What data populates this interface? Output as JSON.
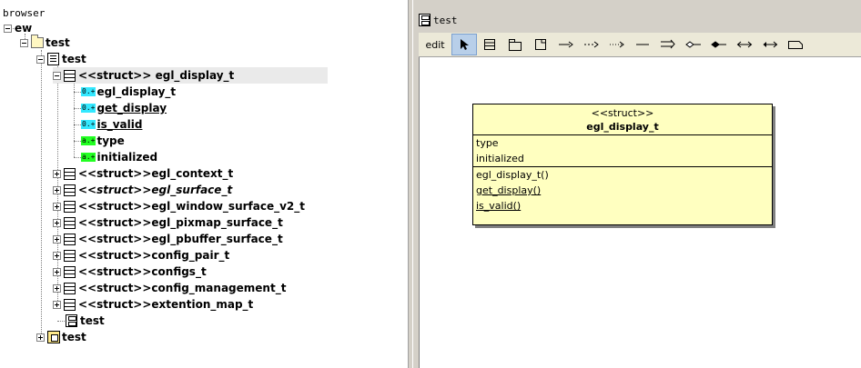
{
  "browser_panel": {
    "label": "browser",
    "root": "ew",
    "package": "test",
    "class_view": "test",
    "struct_egl_display": {
      "label": "<<struct>> egl_display_t",
      "members": [
        {
          "badge": "0.+",
          "kind": "operation",
          "label": "egl_display_t"
        },
        {
          "badge": "0.+",
          "kind": "operation",
          "label": "get_display"
        },
        {
          "badge": "0.+",
          "kind": "operation",
          "label": "is_valid"
        },
        {
          "badge": "a.+",
          "kind": "attribute",
          "label": "type"
        },
        {
          "badge": "a.+",
          "kind": "attribute",
          "label": "initialized"
        }
      ]
    },
    "structs": [
      {
        "prefix": "<<struct>> ",
        "name": "egl_context_t",
        "italic": false
      },
      {
        "prefix": "<<struct>> ",
        "name": "egl_surface_t",
        "italic": true
      },
      {
        "prefix": "<<struct>> ",
        "name": "egl_window_surface_v2_t",
        "italic": false
      },
      {
        "prefix": "<<struct>> ",
        "name": "egl_pixmap_surface_t",
        "italic": false
      },
      {
        "prefix": "<<struct>> ",
        "name": "egl_pbuffer_surface_t",
        "italic": false
      },
      {
        "prefix": "<<struct>> ",
        "name": "config_pair_t",
        "italic": false
      },
      {
        "prefix": "<<struct>> ",
        "name": "configs_t",
        "italic": false
      },
      {
        "prefix": "<<struct>> ",
        "name": "config_management_t",
        "italic": false
      },
      {
        "prefix": "<<struct>> ",
        "name": "extention_map_t",
        "italic": false
      }
    ],
    "diagram": "test",
    "deployment_view": "test"
  },
  "diagram_panel": {
    "tab_title": "test",
    "toolbar": {
      "edit_label": "edit",
      "tools": [
        "select-arrow",
        "class",
        "package",
        "note",
        "generalization",
        "realization",
        "dependency",
        "association",
        "directional-association",
        "aggregation",
        "composition",
        "bidirectional",
        "directional-aggregation",
        "fragment"
      ]
    },
    "uml_class": {
      "stereotype": "<<struct>>",
      "name": "egl_display_t",
      "attributes": [
        "type",
        "initialized"
      ],
      "operations": [
        "egl_display_t()",
        "get_display()",
        "is_valid()"
      ]
    }
  },
  "colors": {
    "op_badge": "#33e8ff",
    "attr_badge": "#22ff22",
    "uml_fill": "#ffffc0",
    "selected_tool": "#b8cfe9"
  }
}
